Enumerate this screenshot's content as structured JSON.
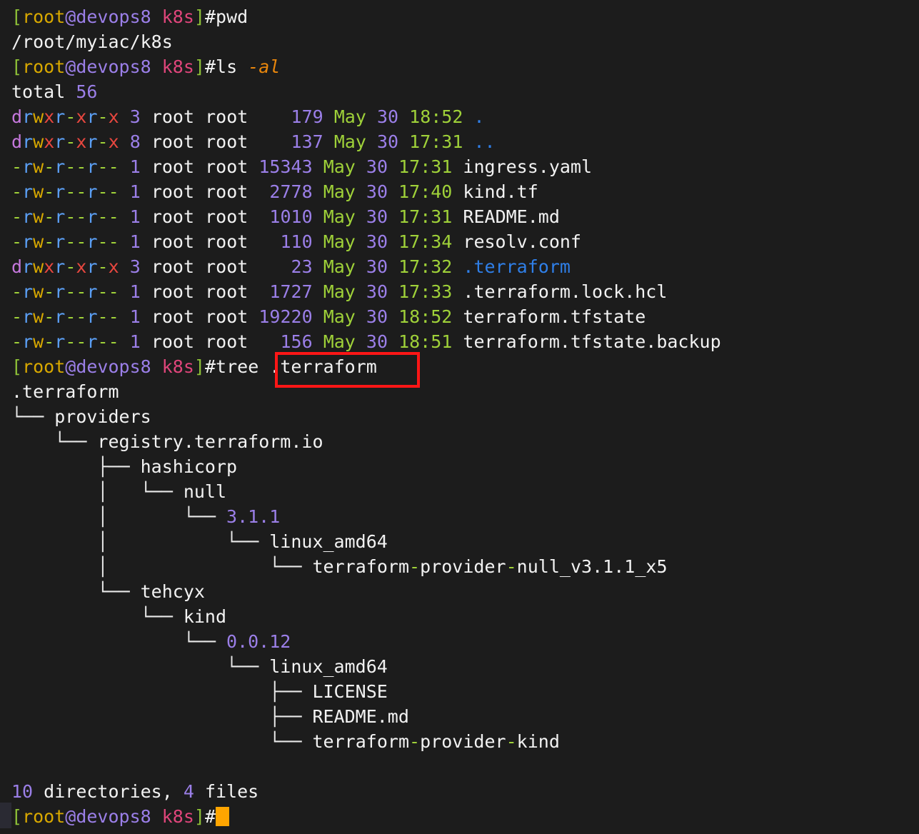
{
  "terminal": {
    "background_color": "#1c1c1c",
    "foreground_color": "#f2f2f2",
    "cursor_color": "#ffa500",
    "annotation_color": "#fe1616",
    "prompt": {
      "open_bracket": "[",
      "user": "root",
      "at_host": "@devops8",
      "space_cwd": " k8s",
      "close_bracket": "]",
      "hash": "#"
    },
    "commands": {
      "pwd": "pwd",
      "pwd_output": "/root/myiac/k8s",
      "ls": "ls",
      "ls_flag": "-al",
      "total_label": "total ",
      "total_value": "56",
      "tree": "tree ",
      "tree_arg": ".terraform"
    },
    "ls_rows": [
      {
        "perm": "drwxr-xr-x",
        "links": "3",
        "owner": "root",
        "group": "root",
        "size": "179",
        "size_pad": "   ",
        "month": "May",
        "day": "30",
        "time": "18:52",
        "name": ".",
        "name_type": "dir"
      },
      {
        "perm": "drwxr-xr-x",
        "links": "8",
        "owner": "root",
        "group": "root",
        "size": "137",
        "size_pad": "   ",
        "month": "May",
        "day": "30",
        "time": "17:31",
        "name": "..",
        "name_type": "dir"
      },
      {
        "perm": "-rw-r--r--",
        "links": "1",
        "owner": "root",
        "group": "root",
        "size": "15343",
        "size_pad": "",
        "month": "May",
        "day": "30",
        "time": "17:31",
        "name": "ingress.yaml",
        "name_type": "file"
      },
      {
        "perm": "-rw-r--r--",
        "links": "1",
        "owner": "root",
        "group": "root",
        "size": "2778",
        "size_pad": " ",
        "month": "May",
        "day": "30",
        "time": "17:40",
        "name": "kind.tf",
        "name_type": "file"
      },
      {
        "perm": "-rw-r--r--",
        "links": "1",
        "owner": "root",
        "group": "root",
        "size": "1010",
        "size_pad": " ",
        "month": "May",
        "day": "30",
        "time": "17:31",
        "name": "README.md",
        "name_type": "file"
      },
      {
        "perm": "-rw-r--r--",
        "links": "1",
        "owner": "root",
        "group": "root",
        "size": "110",
        "size_pad": "  ",
        "month": "May",
        "day": "30",
        "time": "17:34",
        "name": "resolv.conf",
        "name_type": "file"
      },
      {
        "perm": "drwxr-xr-x",
        "links": "3",
        "owner": "root",
        "group": "root",
        "size": "23",
        "size_pad": "   ",
        "month": "May",
        "day": "30",
        "time": "17:32",
        "name": ".terraform",
        "name_type": "dir"
      },
      {
        "perm": "-rw-r--r--",
        "links": "1",
        "owner": "root",
        "group": "root",
        "size": "1727",
        "size_pad": " ",
        "month": "May",
        "day": "30",
        "time": "17:33",
        "name": ".terraform.lock.hcl",
        "name_type": "file"
      },
      {
        "perm": "-rw-r--r--",
        "links": "1",
        "owner": "root",
        "group": "root",
        "size": "19220",
        "size_pad": "",
        "month": "May",
        "day": "30",
        "time": "18:52",
        "name": "terraform.tfstate",
        "name_type": "file"
      },
      {
        "perm": "-rw-r--r--",
        "links": "1",
        "owner": "root",
        "group": "root",
        "size": "156",
        "size_pad": "  ",
        "month": "May",
        "day": "30",
        "time": "18:51",
        "name": "terraform.tfstate.backup",
        "name_type": "file"
      }
    ],
    "tree_output": [
      {
        "prefix": "",
        "name": ".terraform",
        "style": "plain"
      },
      {
        "prefix": "└── ",
        "name": "providers",
        "style": "plain"
      },
      {
        "prefix": "    └── ",
        "name": "registry.terraform.io",
        "style": "plain"
      },
      {
        "prefix": "        ├── ",
        "name": "hashicorp",
        "style": "plain"
      },
      {
        "prefix": "        │   └── ",
        "name": "null",
        "style": "plain"
      },
      {
        "prefix": "        │       └── ",
        "name": "3.1.1",
        "style": "version"
      },
      {
        "prefix": "        │           └── ",
        "name": "linux_amd64",
        "style": "plain"
      },
      {
        "prefix": "        │               └── ",
        "name": "terraform-provider-null_v3.1.1_x5",
        "style": "exec"
      },
      {
        "prefix": "        └── ",
        "name": "tehcyx",
        "style": "plain"
      },
      {
        "prefix": "            └── ",
        "name": "kind",
        "style": "plain"
      },
      {
        "prefix": "                └── ",
        "name": "0.0.12",
        "style": "version"
      },
      {
        "prefix": "                    └── ",
        "name": "linux_amd64",
        "style": "plain"
      },
      {
        "prefix": "                        ├── ",
        "name": "LICENSE",
        "style": "plain"
      },
      {
        "prefix": "                        ├── ",
        "name": "README.md",
        "style": "plain"
      },
      {
        "prefix": "                        └── ",
        "name": "terraform-provider-kind",
        "style": "exec"
      }
    ],
    "summary": {
      "dir_count": "10",
      "dir_label": " directories, ",
      "file_count": "4",
      "file_label": " files"
    }
  }
}
